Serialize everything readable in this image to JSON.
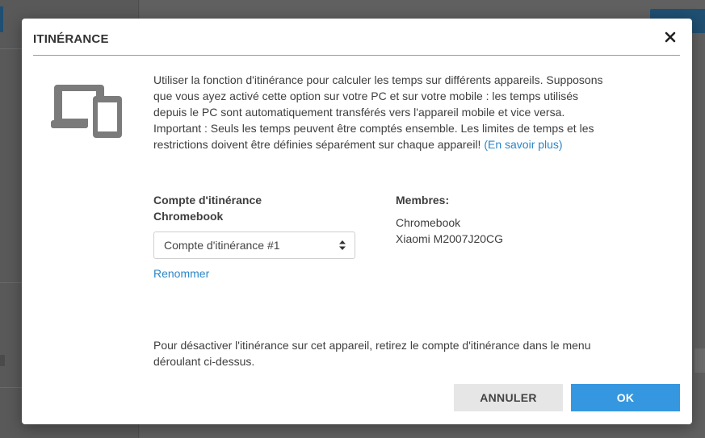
{
  "dialog": {
    "title": "ITINÉRANCE",
    "description": "Utiliser la fonction d'itinérance pour calculer les temps sur différents appareils. Supposons que vous ayez activé cette option sur votre PC et sur votre mobile : les temps utilisés depuis le PC sont automatiquement transférés vers l'appareil mobile et vice versa. Important : Seuls les temps peuvent être comptés ensemble. Les limites de temps et les restrictions doivent être définies séparément sur chaque appareil!",
    "learn_more": "(En savoir plus)",
    "account_label": "Compte d'itinérance Chromebook",
    "account_select_value": "Compte d'itinérance #1",
    "rename_link": "Renommer",
    "members_label": "Membres:",
    "members": [
      "Chromebook",
      "Xiaomi M2007J20CG"
    ],
    "footer_note": "Pour désactiver l'itinérance sur cet appareil, retirez le compte d'itinérance dans le menu déroulant ci-dessus.",
    "cancel_label": "ANNULER",
    "ok_label": "OK"
  },
  "icons": {
    "close": "close-icon",
    "devices": "laptop-phone-icon",
    "select_arrows": "select-updown-icon"
  },
  "colors": {
    "primary": "#3597e0",
    "link": "#2a86c8",
    "cancel_bg": "#e6e6e6",
    "overlay": "#5c5c5c"
  }
}
